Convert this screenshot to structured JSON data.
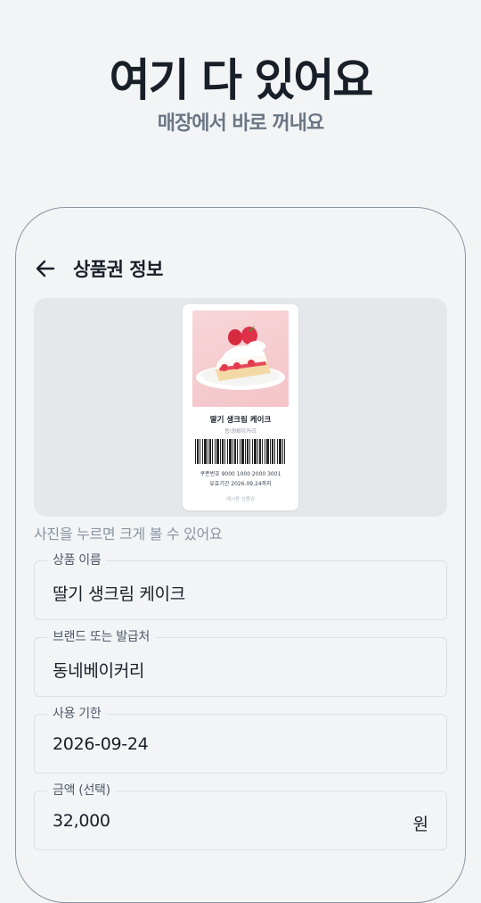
{
  "promo": {
    "headline": "여기 다 있어요",
    "subheadline": "매장에서 바로 꺼내요"
  },
  "screen": {
    "title": "상품권 정보",
    "back_icon": "arrow-left-icon",
    "preview": {
      "coupon": {
        "product_name": "딸기 생크림 케이크",
        "brand": "동네베이커리",
        "coupon_number": "쿠폰번호 9000 1000 2000 3001",
        "expiry": "유효기간 2026.09.24까지",
        "sample_label": "예시용 상품권"
      },
      "hint": "사진을 누르면 크게 볼 수 있어요"
    },
    "fields": [
      {
        "label": "상품 이름",
        "value": "딸기 생크림 케이크"
      },
      {
        "label": "브랜드 또는 발급처",
        "value": "동네베이커리"
      },
      {
        "label": "사용 기한",
        "value": "2026-09-24"
      },
      {
        "label": "금액 (선택)",
        "value": "32,000",
        "unit": "원"
      }
    ]
  },
  "colors": {
    "background": "#f2f4f6",
    "text_primary": "#191f28",
    "text_secondary": "#6b7684",
    "placeholder_gray": "#e5e8eb"
  }
}
